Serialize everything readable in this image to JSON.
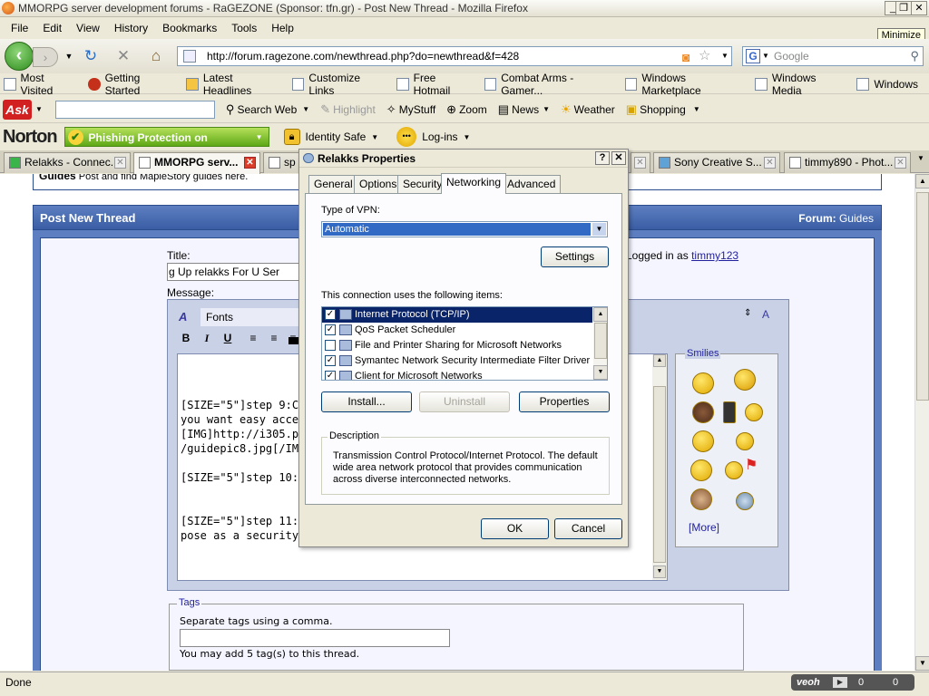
{
  "window": {
    "title": "MMORPG server development forums - RaGEZONE (Sponsor: tfn.gr) - Post New Thread - Mozilla Firefox",
    "minimize_tooltip": "Minimize"
  },
  "menu": [
    "File",
    "Edit",
    "View",
    "History",
    "Bookmarks",
    "Tools",
    "Help"
  ],
  "nav": {
    "url": "http://forum.ragezone.com/newthread.php?do=newthread&f=428",
    "search_placeholder": "Google"
  },
  "bookmarks": [
    "Most Visited",
    "Getting Started",
    "Latest Headlines",
    "Customize Links",
    "Free Hotmail",
    "Combat Arms - Gamer...",
    "Windows Marketplace",
    "Windows Media",
    "Windows"
  ],
  "ask_toolbar": {
    "logo": "Ask",
    "items": [
      "Search Web",
      "Highlight",
      "MyStuff",
      "Zoom",
      "News",
      "Weather",
      "Shopping"
    ]
  },
  "norton": {
    "logo": "Norton",
    "phishing": "Phishing Protection on",
    "identity": "Identity Safe",
    "login": "Log-ins"
  },
  "tabs": [
    "Relakks - Connec...",
    "MMORPG serv...",
    "sp",
    "Sony Creative S...",
    "timmy890 - Phot..."
  ],
  "forum": {
    "guides_title": "Guides",
    "guides_desc": "Post and find MapleStory guides here.",
    "post_title": "Post New Thread",
    "forum_label": "Forum:",
    "forum_name": "Guides",
    "title_label": "Title:",
    "title_value": "g Up relakks For U Ser",
    "logged_in_prefix": "Logged in as",
    "username": "timmy123",
    "message_label": "Message:",
    "fonts_label": "Fonts",
    "message_text": "\n\n\n[SIZE=\"5\"]step 9:Ch                                  if\nyou want easy acce\n[IMG]http://i305.ph\n/guidepic8.jpg[/IMG\n\n[SIZE=\"5\"]step 10:\n\n\n[SIZE=\"5\"]step 11:Y                                  an\npose as a security i",
    "smilies_legend": "Smilies",
    "more_link": "[More]",
    "tags_legend": "Tags",
    "tags_help": "Separate tags using a comma.",
    "tags_limit": "You may add 5 tag(s) to this thread."
  },
  "dialog": {
    "title": "Relakks Properties",
    "tabs": [
      "General",
      "Options",
      "Security",
      "Networking",
      "Advanced"
    ],
    "vpn_label": "Type of VPN:",
    "vpn_value": "Automatic",
    "settings_btn": "Settings",
    "items_label": "This connection uses the following items:",
    "items": [
      {
        "label": "Internet Protocol (TCP/IP)",
        "checked": true
      },
      {
        "label": "QoS Packet Scheduler",
        "checked": true
      },
      {
        "label": "File and Printer Sharing for Microsoft Networks",
        "checked": false
      },
      {
        "label": "Symantec Network Security Intermediate Filter Driver",
        "checked": true
      },
      {
        "label": "Client for Microsoft Networks",
        "checked": true
      }
    ],
    "install_btn": "Install...",
    "uninstall_btn": "Uninstall",
    "properties_btn": "Properties",
    "description_legend": "Description",
    "description_text": "Transmission Control Protocol/Internet Protocol. The default wide area network protocol that provides communication across diverse interconnected networks.",
    "ok_btn": "OK",
    "cancel_btn": "Cancel"
  },
  "status": {
    "text": "Done",
    "veoh": "veoh",
    "count1": "0",
    "count2": "0"
  }
}
